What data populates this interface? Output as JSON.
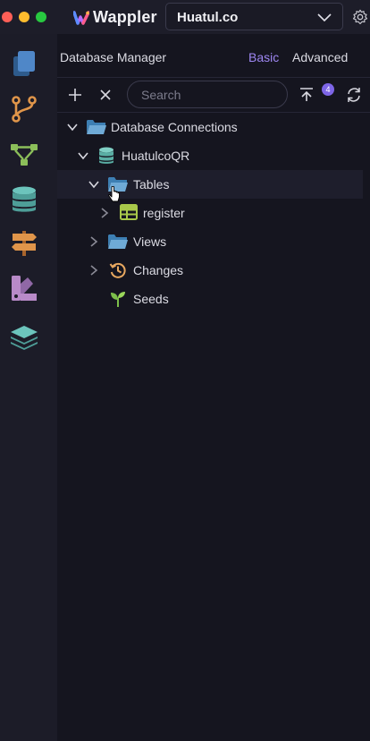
{
  "window": {
    "traffic_lights": [
      "#ff5f57",
      "#febc2e",
      "#28c840"
    ]
  },
  "app": {
    "name": "Wappler",
    "logo_colors": [
      "#5b8dff",
      "#b56cff",
      "#ff5c8a",
      "#ffb347"
    ]
  },
  "project_select": {
    "value": "Huatul.co"
  },
  "sidebar": {
    "items": [
      {
        "name": "files-icon",
        "color": "#4f87c8"
      },
      {
        "name": "git-branch-icon",
        "color": "#e0954a"
      },
      {
        "name": "workflow-icon",
        "color": "#8cbf5a"
      },
      {
        "name": "database-icon",
        "color": "#5ab0aa"
      },
      {
        "name": "routing-signpost-icon",
        "color": "#e0954a"
      },
      {
        "name": "design-swatches-icon",
        "color": "#b88ac8"
      },
      {
        "name": "layers-icon",
        "color": "#5ab0aa"
      }
    ]
  },
  "panel": {
    "title": "Database Manager",
    "modes": {
      "basic": "Basic",
      "advanced": "Advanced",
      "active": "Basic"
    }
  },
  "toolbar": {
    "add_icon": "plus-icon",
    "close_icon": "close-icon",
    "search_placeholder": "Search",
    "search_value": "",
    "apply_icon": "apply-changes-icon",
    "pending_count": "4",
    "refresh_icon": "refresh-icon"
  },
  "tree": {
    "items": [
      {
        "label": "Database Connections",
        "icon": "folder-open-icon",
        "expanded": true
      },
      {
        "label": "HuatulcoQR",
        "icon": "database-icon",
        "expanded": true
      },
      {
        "label": "Tables",
        "icon": "folder-open-icon",
        "expanded": true
      },
      {
        "label": "register",
        "icon": "table-icon",
        "expanded": false
      },
      {
        "label": "Views",
        "icon": "folder-icon",
        "expanded": false
      },
      {
        "label": "Changes",
        "icon": "history-icon",
        "expanded": false
      },
      {
        "label": "Seeds",
        "icon": "sprout-icon",
        "expanded": false
      }
    ]
  }
}
